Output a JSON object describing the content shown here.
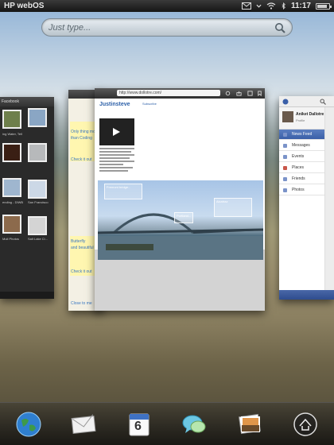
{
  "status_bar": {
    "carrier": "HP webOS",
    "time": "11:17",
    "icons": [
      "mail-icon",
      "wifi-icon",
      "bluetooth-icon",
      "battery-icon"
    ]
  },
  "search": {
    "placeholder": "Just type...",
    "icon": "search-icon"
  },
  "cards": {
    "photos": {
      "header": "Facebook",
      "captions": [
        "ing Water, Tell",
        "",
        "",
        "",
        "ending - DIWB",
        "San Francisco",
        "Mull Photos",
        "Salt Lake Ci..."
      ],
      "color": "#2a2a2a"
    },
    "behind": {
      "texts": [
        "Only thing mo",
        "than Coding",
        "Check it out",
        "Butterfly",
        "and beautiful",
        "Check it out",
        "Close to me"
      ]
    },
    "browser": {
      "url": "http://www.dollotre.com/",
      "blog_title": "Justinsteve",
      "blog_nav": "Subscribe",
      "photo_notes": [
        "Fremont bridge...",
        "Alcatraz",
        "Portland..."
      ]
    },
    "facebook": {
      "user_name": "Aniket Dallotre",
      "user_sub": "Profile",
      "menu": [
        {
          "label": "News Feed",
          "active": true
        },
        {
          "label": "Messages",
          "active": false
        },
        {
          "label": "Events",
          "active": false
        },
        {
          "label": "Places",
          "active": false
        },
        {
          "label": "Friends",
          "active": false
        },
        {
          "label": "Photos",
          "active": false
        }
      ],
      "accent": "#3a5fa8"
    }
  },
  "dock": {
    "icons": [
      "globe-icon",
      "email-icon",
      "calendar-icon",
      "messaging-icon",
      "photos-icon",
      "launcher-icon"
    ],
    "calendar_day": "6"
  }
}
